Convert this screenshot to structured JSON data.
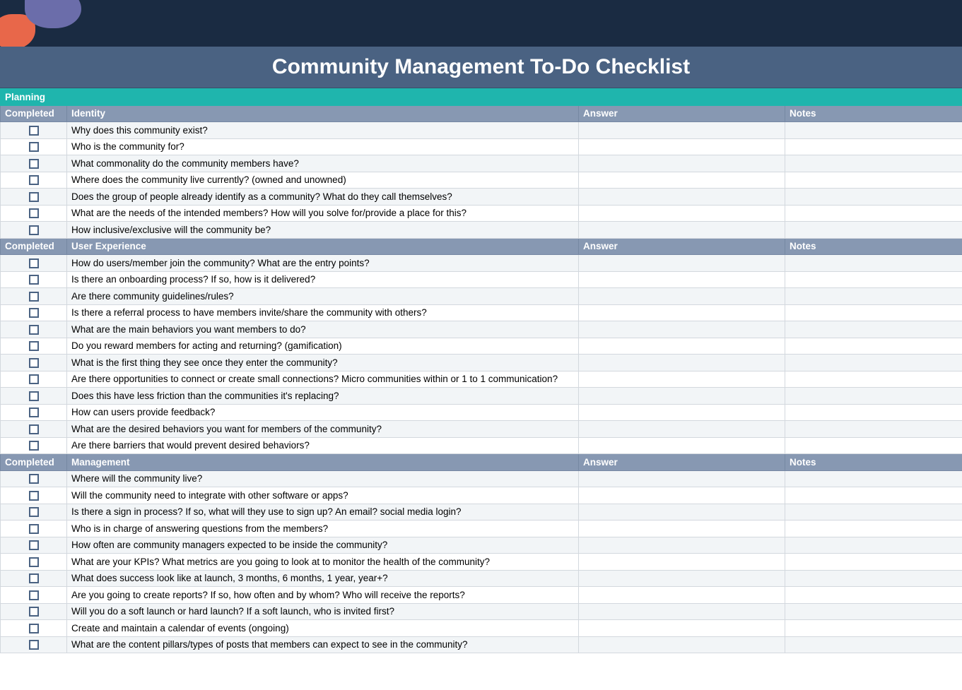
{
  "title": "Community Management To-Do Checklist",
  "section_label": "Planning",
  "columns": {
    "completed": "Completed",
    "answer": "Answer",
    "notes": "Notes"
  },
  "groups": [
    {
      "name": "Identity",
      "rows": [
        "Why does this community exist?",
        "Who is the community for?",
        "What commonality do the community members have?",
        "Where does the community live currently? (owned and unowned)",
        "Does the group of people already identify as a community? What do they call themselves?",
        "What are the needs of the intended members? How will you solve for/provide a place for this?",
        "How inclusive/exclusive will the community be?"
      ]
    },
    {
      "name": "User Experience",
      "rows": [
        "How do users/member join the community? What are the entry points?",
        "Is there an onboarding process? If so, how is it delivered?",
        "Are there community guidelines/rules?",
        "Is there a referral process to have members invite/share the community with others?",
        "What are the main behaviors you want members to do?",
        "Do you reward members for acting and returning? (gamification)",
        "What is the first thing they see once they enter the community?",
        "Are there opportunities to connect or create small connections? Micro communities within or 1 to 1 communication?",
        "Does this have less friction than the communities it's replacing?",
        "How can users provide feedback?",
        "What are the desired behaviors you want for members of the community?",
        "Are there barriers that would prevent desired behaviors?"
      ]
    },
    {
      "name": "Management",
      "rows": [
        "Where will the community live?",
        "Will the community need to integrate with other software or apps?",
        "Is there a sign in process? If so, what will they use to sign up? An email? social media login?",
        "Who is in charge of answering questions from the members?",
        "How often are community managers expected to be inside the community?",
        "What are your KPIs? What metrics are you going to look at to monitor the health of the community?",
        "What does success look like at launch, 3 months, 6 months, 1 year, year+?",
        "Are you going to create reports? If so, how often and by whom? Who will receive the reports?",
        "Will you do a soft launch or hard launch? If a soft launch, who is invited first?",
        "Create and maintain a calendar of events (ongoing)",
        "What are the content pillars/types of posts that members can expect to see in the community?"
      ]
    }
  ]
}
